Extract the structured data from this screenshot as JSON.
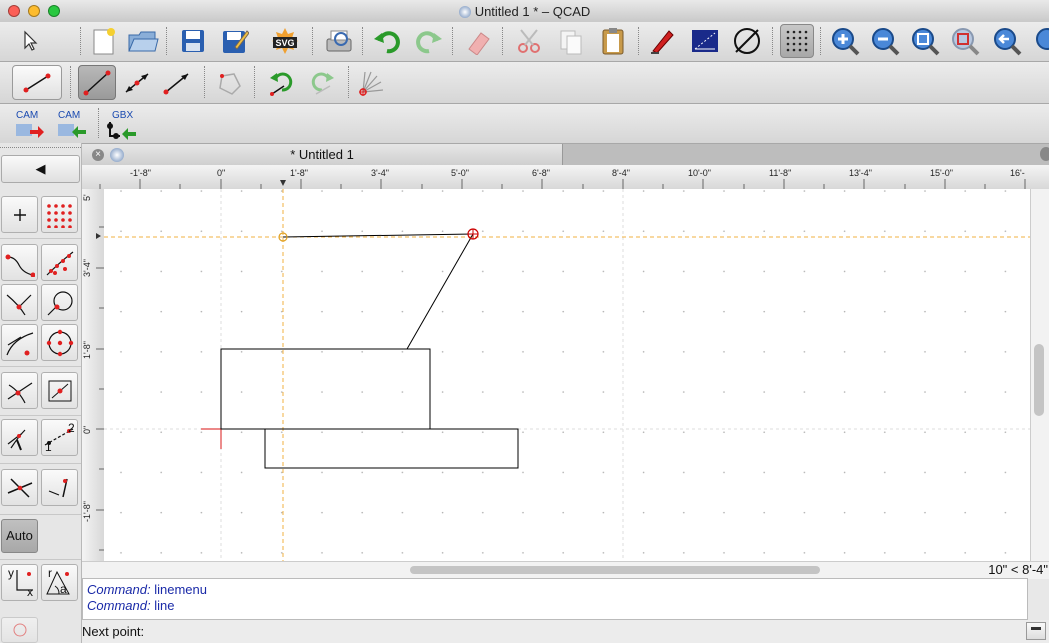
{
  "window": {
    "title": "Untitled 1 * – QCAD"
  },
  "document_tab": {
    "label": "* Untitled 1"
  },
  "ruler": {
    "horizontal_ticks": [
      "-1'-8\"",
      "0\"",
      "1'-8\"",
      "3'-4\"",
      "5'-0\"",
      "6'-8\"",
      "8'-4\"",
      "10'-0\"",
      "11'-8\"",
      "13'-4\"",
      "15'-0\"",
      "16'-"
    ],
    "vertical_ticks": [
      "5'",
      "3'-4\"",
      "1'-8\"",
      "0\"",
      "-1'-8\""
    ]
  },
  "toolbar_icons": {
    "main": [
      "select-icon",
      "new-document-icon",
      "open-folder-icon",
      "save-icon",
      "save-as-icon",
      "svg-export-icon",
      "print-preview-icon",
      "undo-icon",
      "redo-icon",
      "eraser-icon",
      "cut-icon",
      "copy-icon",
      "paste-icon",
      "pen-icon",
      "drawing-properties-icon",
      "no-pen-icon",
      "grid-icon",
      "zoom-in-icon",
      "zoom-out-icon",
      "zoom-auto-icon",
      "zoom-window-icon",
      "zoom-previous-icon"
    ],
    "line": [
      "line-tool-icon",
      "line-two-points-icon",
      "line-angle-icon",
      "line-arrow-icon",
      "polygon-icon",
      "rotate-icon",
      "redo-line-icon",
      "snap-angle-icon"
    ]
  },
  "cam_toolbar": {
    "cam_export": "CAM",
    "cam_import": "CAM",
    "gbx_label": "GBX"
  },
  "left_panel": {
    "back_label": "◀",
    "auto_label": "Auto",
    "label_2": "2",
    "label_1": "1",
    "label_y": "y",
    "label_x": "x",
    "label_r": "r",
    "label_a": "a"
  },
  "status": {
    "relative_coords": "10\" < 8'-4\""
  },
  "command_history": [
    {
      "prefix": "Command:",
      "text": "linemenu"
    },
    {
      "prefix": "Command:",
      "text": "line"
    }
  ],
  "command_line": {
    "label": "Next point:",
    "value": ""
  },
  "colors": {
    "accent": "#2a6ac8",
    "crosshair": "#e8b040",
    "cursor_red": "#cc0000"
  }
}
